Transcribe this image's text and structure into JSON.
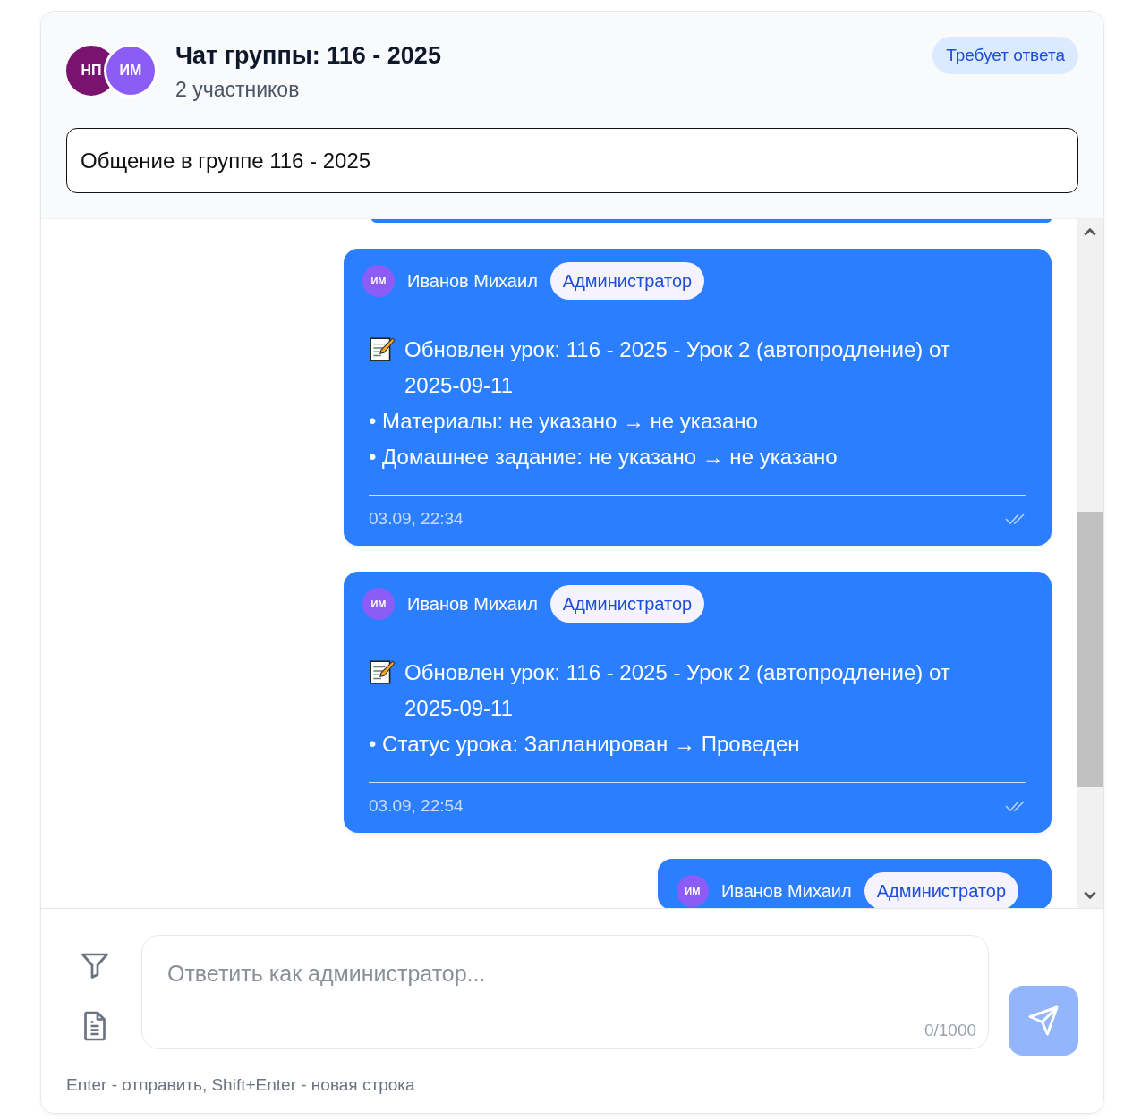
{
  "header": {
    "participants": [
      {
        "initials": "НП",
        "color": "#7a136f"
      },
      {
        "initials": "ИМ",
        "color": "#8b5cf6"
      }
    ],
    "title": "Чат группы: 116 - 2025",
    "subtitle": "2 участников",
    "status_badge": "Требует ответа",
    "topic_field": {
      "value": "Общение в группе 116 - 2025"
    }
  },
  "messages": [
    {
      "kind": "edge"
    },
    {
      "kind": "full",
      "initials": "ИМ",
      "color": "#8b5cf6",
      "sender": "Иванов Михаил",
      "role": "Администратор",
      "lines": [
        {
          "kind": "update",
          "text": "Обновлен урок: 116 - 2025 - Урок 2 (автопродление) от 2025-09-11"
        },
        {
          "kind": "plain",
          "text": "• Материалы: не указано → не указано"
        },
        {
          "kind": "plain",
          "text": "• Домашнее задание: не указано → не указано"
        }
      ],
      "time": "03.09, 22:34",
      "read": true
    },
    {
      "kind": "full",
      "initials": "ИМ",
      "color": "#8b5cf6",
      "sender": "Иванов Михаил",
      "role": "Администратор",
      "lines": [
        {
          "kind": "update",
          "text": "Обновлен урок: 116 - 2025 - Урок 2 (автопродление) от 2025-09-11"
        },
        {
          "kind": "plain",
          "text": "• Статус урока: Запланирован → Проведен"
        }
      ],
      "time": "03.09, 22:54",
      "read": true
    },
    {
      "kind": "cut",
      "initials": "ИМ",
      "color": "#8b5cf6",
      "sender": "Иванов Михаил",
      "role": "Администратор"
    }
  ],
  "composer": {
    "placeholder": "Ответить как администратор...",
    "counter": "0/1000",
    "send_disabled": true,
    "hint": "Enter - отправить, Shift+Enter - новая строка"
  }
}
